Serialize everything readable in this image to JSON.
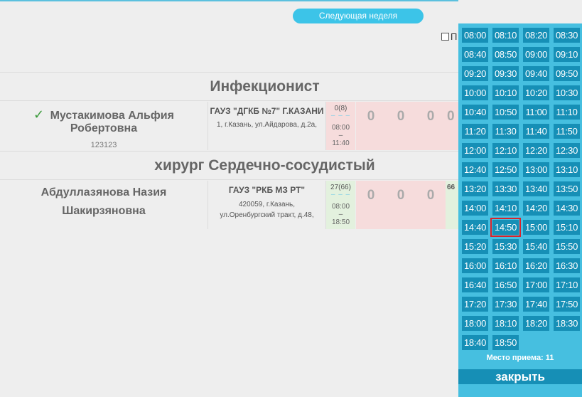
{
  "header": {
    "next_week_label": "Следующая неделя",
    "checkbox_label": "П"
  },
  "specialties": [
    {
      "title": "Инфекционист",
      "doctor": {
        "name": "Мустакимова Альфия Робертовна",
        "id": "123123",
        "clinic": "ГАУЗ \"ДГКБ №7\" Г.КАЗАНИ",
        "address": "1, г.Казань, ул.Айдарова, д.2а,",
        "slot": {
          "count": "0(8)",
          "dashes": "– – –",
          "from": "08:00",
          "sep": "–",
          "to": "11:40"
        },
        "days": [
          "0",
          "0",
          "0",
          "0"
        ]
      }
    },
    {
      "title": "хирург Сердечно-сосудистый",
      "doctor": {
        "name_line1": "Абдуллазянова Назия",
        "name_line2": "Шакирзяновна",
        "clinic": "ГАУЗ \"РКБ МЗ РТ\"",
        "address_line1": "420059, г.Казань,",
        "address_line2": "ул.Оренбургский тракт, д.48,",
        "slot": {
          "count": "27(66)",
          "dashes": "– – –",
          "from": "08:00",
          "sep": "–",
          "to": "18:50"
        },
        "days": [
          "0",
          "0",
          "0",
          "66"
        ]
      }
    }
  ],
  "picker": {
    "times": [
      "08:00",
      "08:10",
      "08:20",
      "08:30",
      "08:40",
      "08:50",
      "09:00",
      "09:10",
      "09:20",
      "09:30",
      "09:40",
      "09:50",
      "10:00",
      "10:10",
      "10:20",
      "10:30",
      "10:40",
      "10:50",
      "11:00",
      "11:10",
      "11:20",
      "11:30",
      "11:40",
      "11:50",
      "12:00",
      "12:10",
      "12:20",
      "12:30",
      "12:40",
      "12:50",
      "13:00",
      "13:10",
      "13:20",
      "13:30",
      "13:40",
      "13:50",
      "14:00",
      "14:10",
      "14:20",
      "14:30",
      "14:40",
      "14:50",
      "15:00",
      "15:10",
      "15:20",
      "15:30",
      "15:40",
      "15:50",
      "16:00",
      "16:10",
      "16:20",
      "16:30",
      "16:40",
      "16:50",
      "17:00",
      "17:10",
      "17:20",
      "17:30",
      "17:40",
      "17:50",
      "18:00",
      "18:10",
      "18:20",
      "18:30",
      "18:40",
      "18:50"
    ],
    "selected": "14:50",
    "place_label": "Место приема: 11",
    "close_label": "закрыть"
  },
  "colors": {
    "accent": "#46bfe0",
    "button": "#168fb6",
    "selected_outline": "#d9222a",
    "check": "#3a9a3a"
  }
}
